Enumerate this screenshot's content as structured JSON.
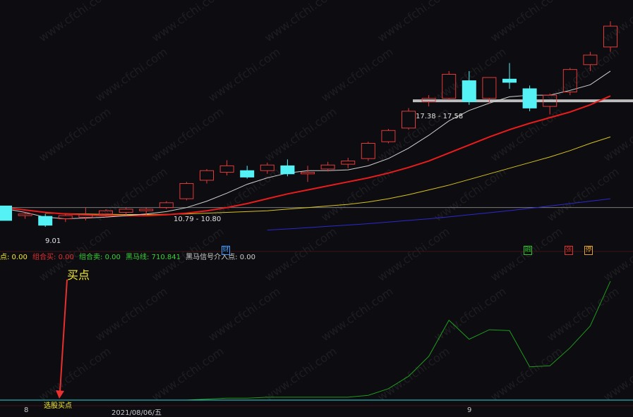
{
  "info_bar": [
    {
      "text": "点: 0.00",
      "color": "#f3ea2d"
    },
    {
      "text": "组合买: 0.00",
      "color": "#e03030"
    },
    {
      "text": "组合卖: 0.00",
      "color": "#37d337"
    },
    {
      "text": "黑马线: 710.841",
      "color": "#37d337"
    },
    {
      "text": "黑马信号介入点: 0.00",
      "color": "#cfcfcf"
    }
  ],
  "annotations": {
    "buy_point": "买点",
    "select_stock_buy": "选股买点",
    "low_value": "9.01",
    "range_low": "10.79 - 10.80",
    "range_high": "17.38 - 17.58"
  },
  "markers": [
    {
      "text": "财",
      "color": "#3fa0ff"
    },
    {
      "text": "融",
      "color": "#2fc22f"
    },
    {
      "text": "张",
      "color": "#e03030"
    },
    {
      "text": "停",
      "color": "#e0a030"
    }
  ],
  "x_ticks": [
    "8",
    "2021/08/06/五",
    "9"
  ],
  "colors": {
    "up": "#e03a3a",
    "down": "#55f2f5",
    "ma5": "#d0d0d0",
    "ma10": "#e81c1c",
    "ma20": "#d6c31c",
    "ma60": "#2a2ad0",
    "indicator": "#1e9a1e",
    "grid": "#7a7a7a"
  },
  "chart_data": [
    {
      "type": "candlestick",
      "title": "",
      "candles": [
        {
          "o": 10.95,
          "h": 10.95,
          "l": 10.05,
          "c": 10.05
        },
        {
          "o": 10.35,
          "h": 10.55,
          "l": 10.15,
          "c": 10.45
        },
        {
          "o": 10.3,
          "h": 10.45,
          "l": 9.65,
          "c": 9.75
        },
        {
          "o": 10.15,
          "h": 10.45,
          "l": 9.95,
          "c": 10.35
        },
        {
          "o": 10.25,
          "h": 10.85,
          "l": 10.05,
          "c": 10.4
        },
        {
          "o": 10.45,
          "h": 10.75,
          "l": 10.25,
          "c": 10.65
        },
        {
          "o": 10.55,
          "h": 10.85,
          "l": 10.35,
          "c": 10.75
        },
        {
          "o": 10.65,
          "h": 10.85,
          "l": 10.4,
          "c": 10.75
        },
        {
          "o": 10.85,
          "h": 11.25,
          "l": 10.75,
          "c": 11.15
        },
        {
          "o": 11.4,
          "h": 12.45,
          "l": 11.3,
          "c": 12.35
        },
        {
          "o": 12.55,
          "h": 13.25,
          "l": 12.35,
          "c": 13.15
        },
        {
          "o": 13.05,
          "h": 13.8,
          "l": 12.85,
          "c": 13.45
        },
        {
          "o": 13.15,
          "h": 13.45,
          "l": 12.65,
          "c": 12.75
        },
        {
          "o": 13.15,
          "h": 13.65,
          "l": 12.95,
          "c": 13.5
        },
        {
          "o": 13.45,
          "h": 13.85,
          "l": 12.8,
          "c": 12.95
        },
        {
          "o": 12.95,
          "h": 13.45,
          "l": 12.45,
          "c": 13.05
        },
        {
          "o": 13.25,
          "h": 13.7,
          "l": 13.1,
          "c": 13.5
        },
        {
          "o": 13.55,
          "h": 13.95,
          "l": 13.3,
          "c": 13.75
        },
        {
          "o": 13.9,
          "h": 14.95,
          "l": 13.75,
          "c": 14.85
        },
        {
          "o": 14.95,
          "h": 15.75,
          "l": 14.85,
          "c": 15.65
        },
        {
          "o": 15.8,
          "h": 17.05,
          "l": 15.7,
          "c": 16.85
        },
        {
          "o": 17.45,
          "h": 17.85,
          "l": 17.15,
          "c": 17.65
        },
        {
          "o": 17.65,
          "h": 19.35,
          "l": 17.55,
          "c": 19.15
        },
        {
          "o": 18.75,
          "h": 19.35,
          "l": 17.25,
          "c": 17.45
        },
        {
          "o": 17.65,
          "h": 18.95,
          "l": 17.35,
          "c": 18.95
        },
        {
          "o": 18.85,
          "h": 19.85,
          "l": 18.25,
          "c": 18.65
        },
        {
          "o": 18.25,
          "h": 18.45,
          "l": 16.85,
          "c": 17.05
        },
        {
          "o": 17.15,
          "h": 17.95,
          "l": 16.65,
          "c": 17.85
        },
        {
          "o": 18.05,
          "h": 19.55,
          "l": 17.85,
          "c": 19.45
        },
        {
          "o": 19.75,
          "h": 20.55,
          "l": 19.35,
          "c": 20.35
        },
        {
          "o": 20.85,
          "h": 22.45,
          "l": 20.55,
          "c": 22.15
        }
      ],
      "ma5": [
        10.78,
        10.55,
        10.25,
        10.15,
        10.2,
        10.25,
        10.35,
        10.45,
        10.6,
        10.85,
        11.25,
        11.75,
        12.3,
        12.7,
        13.0,
        13.15,
        13.15,
        13.2,
        13.45,
        13.9,
        14.55,
        15.35,
        16.25,
        16.9,
        17.35,
        17.75,
        17.85,
        17.85,
        18.15,
        18.5,
        19.35
      ],
      "ma10": [
        10.85,
        10.7,
        10.55,
        10.45,
        10.4,
        10.35,
        10.35,
        10.35,
        10.4,
        10.5,
        10.65,
        10.85,
        11.1,
        11.4,
        11.7,
        11.95,
        12.2,
        12.45,
        12.7,
        13.0,
        13.35,
        13.75,
        14.25,
        14.75,
        15.25,
        15.7,
        16.1,
        16.45,
        16.8,
        17.25,
        17.8
      ],
      "ma20_start_index": 2,
      "ma20": [
        10.5,
        10.47,
        10.45,
        10.43,
        10.42,
        10.42,
        10.43,
        10.45,
        10.5,
        10.55,
        10.6,
        10.65,
        10.75,
        10.85,
        10.95,
        11.05,
        11.2,
        11.4,
        11.65,
        11.95,
        12.25,
        12.6,
        12.95,
        13.3,
        13.65,
        14.0,
        14.4,
        14.85,
        15.25
      ],
      "ma60_start_index": 13,
      "ma60": [
        9.45,
        9.52,
        9.6,
        9.68,
        9.76,
        9.85,
        9.95,
        10.05,
        10.15,
        10.27,
        10.4,
        10.53,
        10.66,
        10.8,
        10.95,
        11.1,
        11.25,
        11.4
      ],
      "h_lines": [
        10.85,
        17.5
      ],
      "y_range": [
        9.3,
        22.9
      ]
    },
    {
      "type": "line",
      "title": "",
      "values": [
        0,
        0,
        0,
        0,
        0,
        0,
        0,
        0,
        0,
        0,
        5,
        10,
        10,
        15,
        15,
        15,
        15,
        15,
        25,
        60,
        125,
        230,
        420,
        320,
        370,
        365,
        175,
        180,
        275,
        390,
        625
      ],
      "y_range": [
        0,
        710.841
      ]
    }
  ]
}
